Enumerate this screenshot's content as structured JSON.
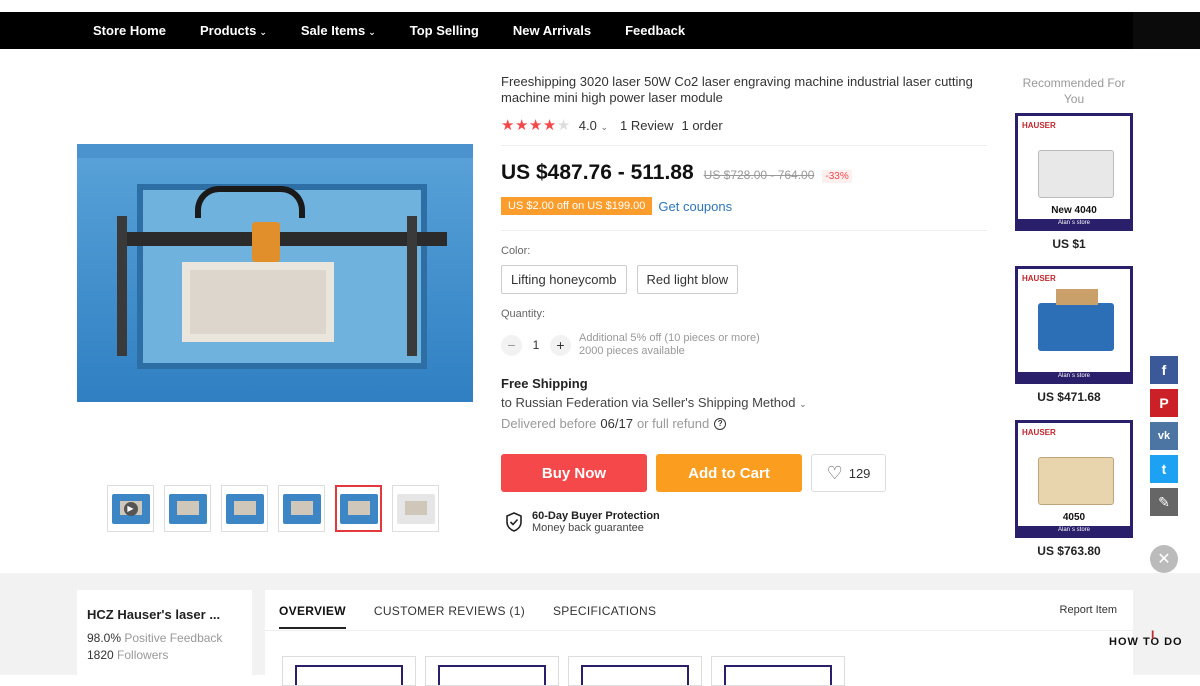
{
  "nav": {
    "items": [
      {
        "label": "Store Home",
        "dropdown": false
      },
      {
        "label": "Products",
        "dropdown": true
      },
      {
        "label": "Sale Items",
        "dropdown": true
      },
      {
        "label": "Top Selling",
        "dropdown": false
      },
      {
        "label": "New Arrivals",
        "dropdown": false
      },
      {
        "label": "Feedback",
        "dropdown": false
      }
    ],
    "chevron": "⌄"
  },
  "product": {
    "title": "Freeshipping 3020 laser 50W Co2 laser engraving machine industrial laser cutting machine mini high power laser module",
    "rating_value": "4.0",
    "rating_stars": 4,
    "rating_chevron": "⌄",
    "reviews": "1 Review",
    "orders": "1 order",
    "price": "US $487.76 - 511.88",
    "old_price": "US $728.00 - 764.00",
    "discount": "-33%",
    "coupon": "US $2.00 off on US $199.00",
    "get_coupons": "Get coupons",
    "color_label": "Color:",
    "color_options": [
      "Lifting honeycomb",
      "Red light blow"
    ],
    "quantity_label": "Quantity:",
    "quantity_value": "1",
    "qty_minus": "−",
    "qty_plus": "+",
    "qty_note_1": "Additional 5% off (10 pieces or more)",
    "qty_note_2": "2000 pieces available",
    "shipping_title": "Free Shipping",
    "shipping_to": "to Russian Federation via Seller's Shipping Method",
    "shipping_chevron": "⌄",
    "delivery_prefix": "Delivered before",
    "delivery_date": "06/17",
    "delivery_suffix": "or full refund",
    "delivery_help": "?",
    "buy_now": "Buy Now",
    "add_to_cart": "Add to Cart",
    "wishlist_count": "129",
    "heart": "♡",
    "protection_title": "60-Day Buyer Protection",
    "protection_sub": "Money back guarantee",
    "thumbnail_count": 6,
    "thumbnail_active": 4
  },
  "recommended": {
    "title": "Recommended For You",
    "items": [
      {
        "caption": "New 4040",
        "price": "US $1",
        "logo": "HAUSER",
        "band": "Alan´s store"
      },
      {
        "caption": "",
        "price": "US $471.68",
        "logo": "HAUSER",
        "band": "Alan´s store"
      },
      {
        "caption": "4050",
        "price": "US $763.80",
        "logo": "HAUSER",
        "band": "Alan´s store"
      }
    ]
  },
  "social": {
    "facebook": "f",
    "pinterest": "P",
    "vk": "vk",
    "twitter": "t",
    "edit": "✎",
    "close": "✕"
  },
  "store": {
    "name": "HCZ Hauser's laser ...",
    "feedback_value": "98.0%",
    "feedback_label": "Positive Feedback",
    "followers_value": "1820",
    "followers_label": "Followers"
  },
  "tabs": {
    "items": [
      "OVERVIEW",
      "CUSTOMER REVIEWS (1)",
      "SPECIFICATIONS"
    ],
    "active": 0,
    "report": "Report Item"
  },
  "watermark": {
    "text": "HOW TO DO",
    "accent": "I"
  },
  "colors": {
    "accent_red": "#f5484a",
    "accent_orange": "#fb9d1f",
    "link_blue": "#2e76b9",
    "nav_bg": "#000000"
  }
}
